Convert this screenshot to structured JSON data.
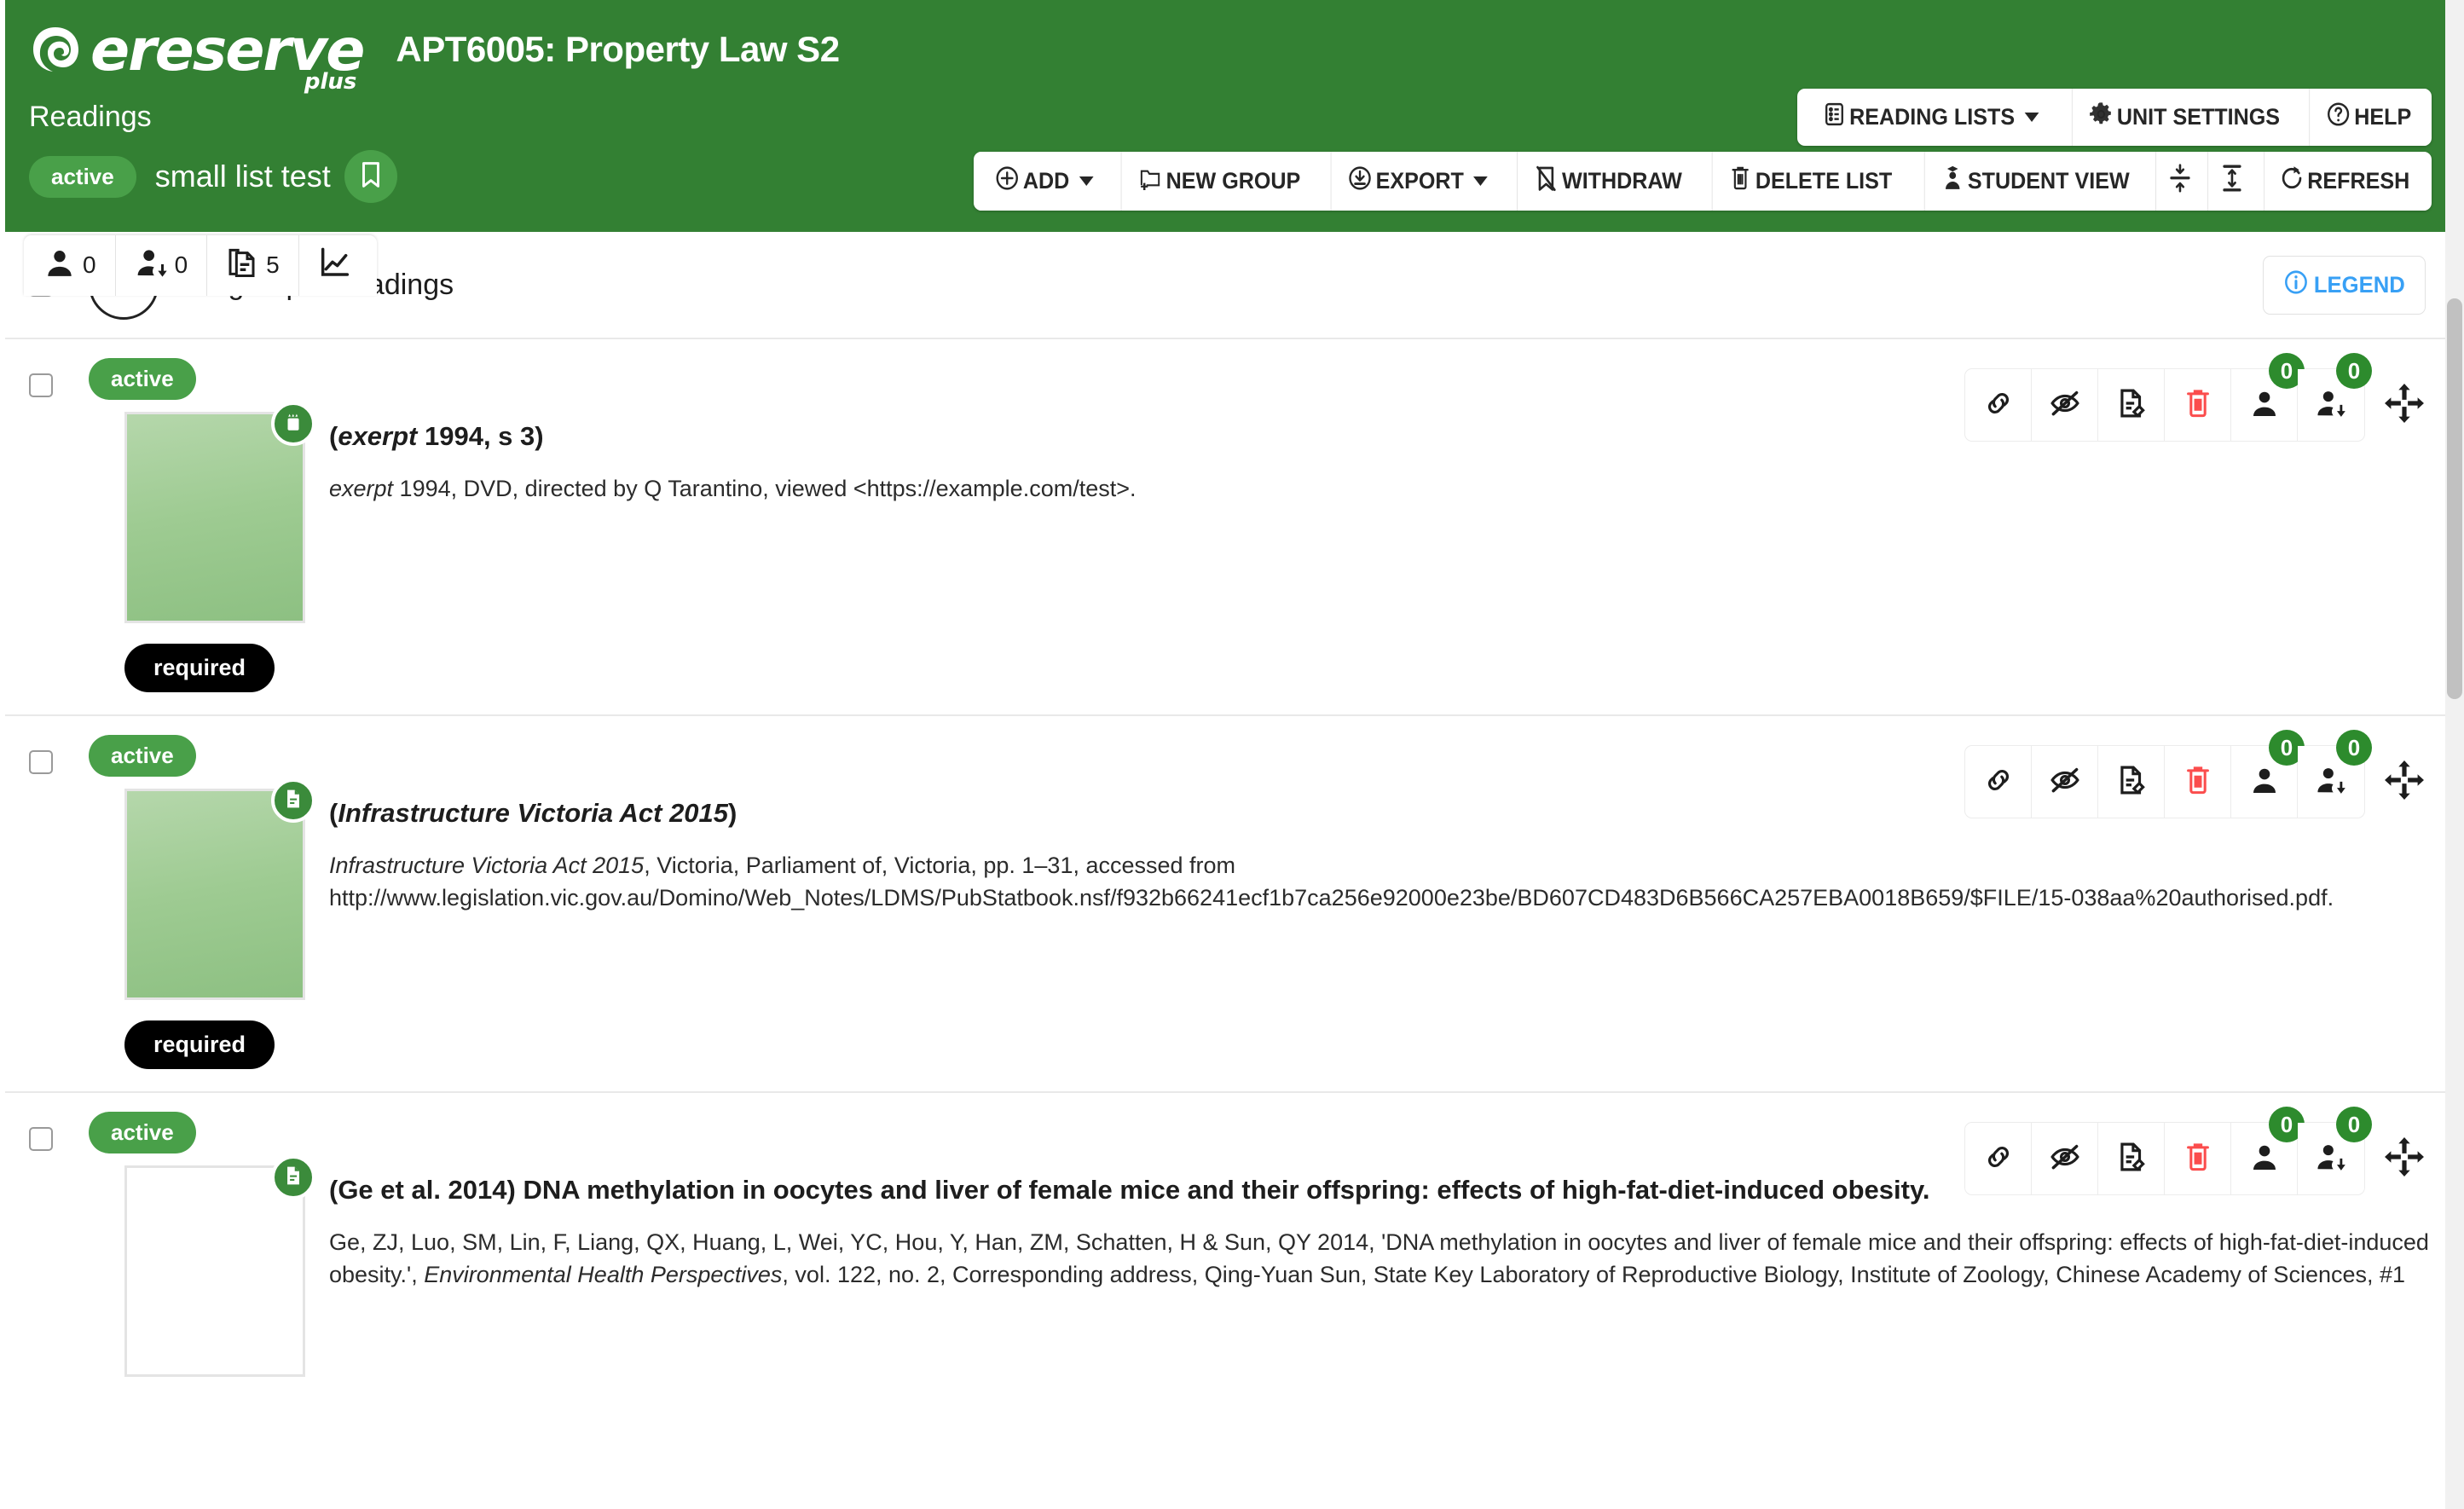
{
  "brand": {
    "logo_icon": "ereserve-spiral-logo-icon",
    "name": "ereserve",
    "tagline": "plus",
    "primary_color": "#338033",
    "accent_green": "#49a049",
    "link_blue": "#38a0f5",
    "danger_red": "#fb4d4d"
  },
  "header": {
    "unit_title": "APT6005: Property Law S2",
    "section_label": "Readings",
    "nav_buttons": [
      {
        "label": "READING LISTS",
        "icon": "list-icon",
        "has_caret": true
      },
      {
        "label": "UNIT SETTINGS",
        "icon": "gear-icon",
        "has_caret": false
      },
      {
        "label": "HELP",
        "icon": "question-circle-icon",
        "has_caret": false
      }
    ]
  },
  "list": {
    "status": "active",
    "name": "small list test",
    "bookmark_icon": "bookmark-icon",
    "stats": [
      {
        "icon": "user-icon",
        "value": "0",
        "name": "enrolled-students"
      },
      {
        "icon": "user-download-icon",
        "value": "0",
        "name": "student-downloads"
      },
      {
        "icon": "documents-icon",
        "value": "5",
        "name": "readings-count"
      },
      {
        "icon": "chart-line-icon",
        "value": "",
        "name": "analytics"
      }
    ]
  },
  "toolbar": [
    {
      "label": "ADD",
      "icon": "plus-circle-icon",
      "has_caret": true
    },
    {
      "label": "NEW GROUP",
      "icon": "folder-plus-icon",
      "has_caret": false
    },
    {
      "label": "EXPORT",
      "icon": "download-circle-icon",
      "has_caret": true
    },
    {
      "label": "WITHDRAW",
      "icon": "bookmark-slash-icon",
      "has_caret": false
    },
    {
      "label": "DELETE LIST",
      "icon": "trash-icon",
      "has_caret": false
    },
    {
      "label": "STUDENT VIEW",
      "icon": "graduate-icon",
      "has_caret": false
    },
    {
      "label": "",
      "icon": "collapse-all-icon",
      "has_caret": false
    },
    {
      "label": "",
      "icon": "expand-all-icon",
      "has_caret": false
    },
    {
      "label": "REFRESH",
      "icon": "refresh-icon",
      "has_caret": false
    }
  ],
  "group": {
    "title": "Ungrouped readings",
    "folder_icon": "folder-icon",
    "legend_label": "LEGEND",
    "legend_icon": "info-circle-icon"
  },
  "row_actions": [
    {
      "icon": "link-icon",
      "name": "copy-link-action",
      "badge": null
    },
    {
      "icon": "eye-slash-icon",
      "name": "hide-action",
      "badge": null
    },
    {
      "icon": "document-edit-icon",
      "name": "edit-citation-action",
      "badge": null
    },
    {
      "icon": "trash-icon",
      "name": "delete-reading-action",
      "badge": null,
      "color": "#fb4d4d"
    },
    {
      "icon": "user-icon",
      "name": "views-action",
      "badge": "0"
    },
    {
      "icon": "user-download-icon",
      "name": "downloads-action",
      "badge": "0"
    }
  ],
  "move_handle_icon": "move-arrows-icon",
  "readings": [
    {
      "status": "active",
      "type_badge_icon": "film-icon",
      "thumbnail": "green-gradient-preview",
      "thumbnail_blank": false,
      "title_prefix": "(",
      "title_italic": "exerpt",
      "title_rest": " 1994, s 3)",
      "citation_parts": [
        {
          "text": "exerpt",
          "italic": true
        },
        {
          "text": " 1994, DVD, directed by Q Tarantino, viewed <https://example.com/test>.",
          "italic": false
        }
      ],
      "requirement": "required"
    },
    {
      "status": "active",
      "type_badge_icon": "document-icon",
      "thumbnail": "green-gradient-preview",
      "thumbnail_blank": false,
      "title_prefix": "(",
      "title_italic": "Infrastructure Victoria Act 2015",
      "title_rest": ")",
      "citation_parts": [
        {
          "text": "Infrastructure Victoria Act 2015",
          "italic": true
        },
        {
          "text": ", Victoria, Parliament of, Victoria, pp. 1–31, accessed from http://www.legislation.vic.gov.au/Domino/Web_Notes/LDMS/PubStatbook.nsf/f932b66241ecf1b7ca256e92000e23be/BD607CD483D6B566CA257EBA0018B659/$FILE/15-038aa%20authorised.pdf.",
          "italic": false
        }
      ],
      "requirement": "required"
    },
    {
      "status": "active",
      "type_badge_icon": "document-icon",
      "thumbnail": "blank-preview",
      "thumbnail_blank": true,
      "title_prefix": "",
      "title_italic": "",
      "title_rest": "(Ge et al. 2014) DNA methylation in oocytes and liver of female mice and their offspring: effects of high-fat-diet-induced obesity.",
      "citation_parts": [
        {
          "text": "Ge, ZJ, Luo, SM, Lin, F, Liang, QX, Huang, L, Wei, YC, Hou, Y, Han, ZM, Schatten, H & Sun, QY 2014, 'DNA methylation in oocytes and liver of female mice and their offspring: effects of high-fat-diet-induced obesity.', ",
          "italic": false
        },
        {
          "text": "Environmental Health Perspectives",
          "italic": true
        },
        {
          "text": ", vol. 122, no. 2, Corresponding address, Qing-Yuan Sun, State Key Laboratory of Reproductive Biology, Institute of Zoology, Chinese Academy of Sciences, #1",
          "italic": false
        }
      ],
      "requirement": ""
    }
  ]
}
